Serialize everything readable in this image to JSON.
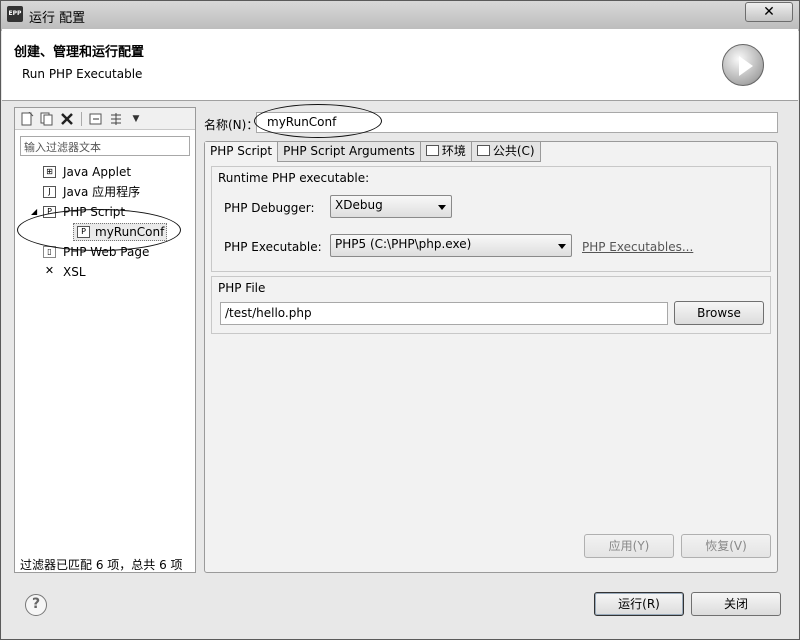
{
  "window": {
    "title": "运行 配置",
    "app_icon": "EPP",
    "close_glyph": "✕"
  },
  "header": {
    "title": "创建、管理和运行配置",
    "subtitle": "Run PHP Executable"
  },
  "left": {
    "toolbar_icons": [
      "new-config-icon",
      "duplicate-icon",
      "delete-icon",
      "collapse-icon",
      "filter-icon"
    ],
    "filter_placeholder": "输入过滤器文本",
    "tree": [
      {
        "label": "Java Applet",
        "icon": "java-applet-icon",
        "glyph": "⊞",
        "level": 0
      },
      {
        "label": "Java 应用程序",
        "icon": "java-app-icon",
        "glyph": "J",
        "level": 0
      },
      {
        "label": "PHP Script",
        "icon": "php-script-icon",
        "glyph": "P",
        "level": 0,
        "expanded": true
      },
      {
        "label": "myRunConf",
        "icon": "php-config-icon",
        "glyph": "P",
        "level": 1,
        "selected": true
      },
      {
        "label": "PHP Web Page",
        "icon": "php-web-page-icon",
        "glyph": "▯",
        "level": 0
      },
      {
        "label": "XSL",
        "icon": "xsl-icon",
        "glyph": "✕",
        "level": 0
      }
    ],
    "match_text": "过滤器已匹配 6 项，总共 6 项"
  },
  "right": {
    "name_label": "名称(N)：",
    "name_value": "myRunConf",
    "tabs": [
      {
        "label": "PHP Script",
        "active": true,
        "icon": ""
      },
      {
        "label": "PHP Script Arguments",
        "active": false,
        "icon": ""
      },
      {
        "label": "环境",
        "active": false,
        "icon": "environment-icon"
      },
      {
        "label": "公共(C)",
        "active": false,
        "icon": "common-icon"
      }
    ],
    "runtime_group": "Runtime PHP executable:",
    "debugger_label": "PHP Debugger:",
    "debugger_value": "XDebug",
    "executable_label": "PHP Executable:",
    "executable_value": "PHP5 (C:\\PHP\\php.exe)",
    "executables_link": "PHP Executables...",
    "file_group": "PHP File",
    "file_value": "/test/hello.php",
    "browse_label": "Browse",
    "apply_label": "应用(Y)",
    "revert_label": "恢复(V)"
  },
  "footer": {
    "run_label": "运行(R)",
    "close_label": "关闭",
    "help_glyph": "?"
  }
}
